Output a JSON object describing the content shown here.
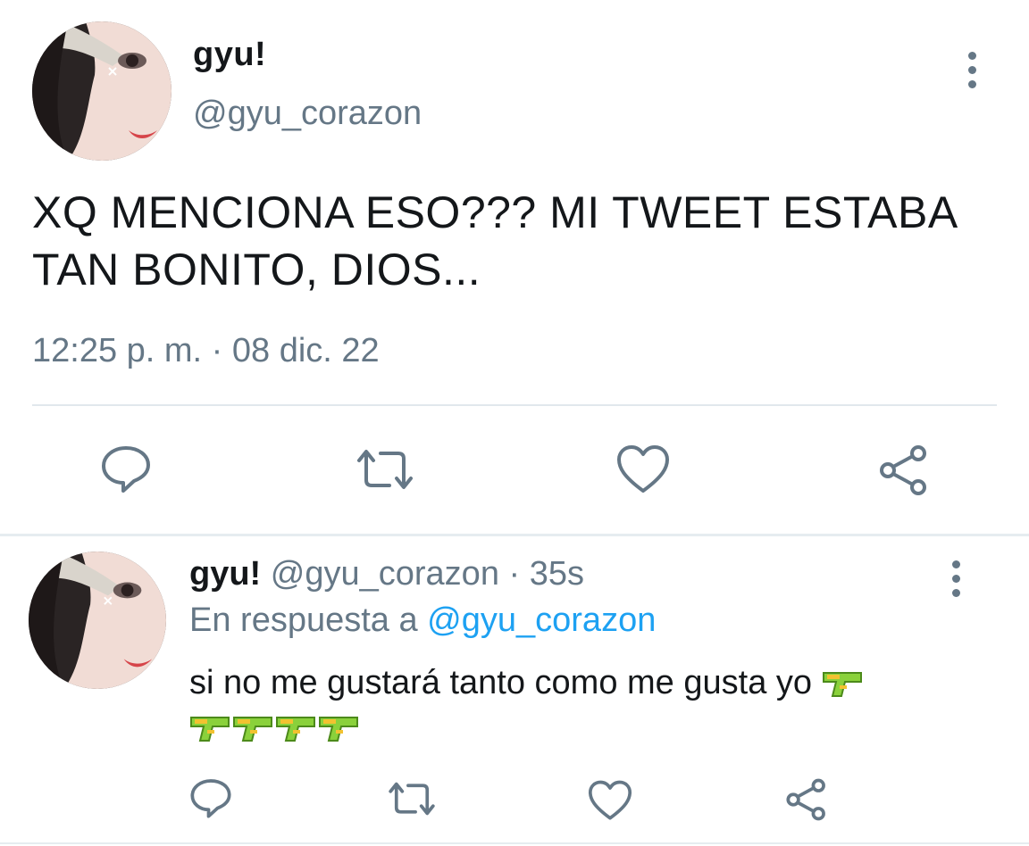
{
  "main_tweet": {
    "display_name": "gyu!",
    "handle": "@gyu_corazon",
    "text": "XQ MENCIONA ESO??? MI TWEET ESTABA TAN BONITO, DIOS...",
    "timestamp": "12:25 p. m. · 08 dic. 22",
    "icons": {
      "more": "more-vertical-icon",
      "reply": "comment-icon",
      "retweet": "retweet-icon",
      "like": "heart-icon",
      "share": "share-icon"
    }
  },
  "reply_tweet": {
    "display_name": "gyu!",
    "handle": "@gyu_corazon",
    "time": "· 35s",
    "replying_to_label": "En respuesta a",
    "replying_to_handle": "@gyu_corazon",
    "text": "si no me gustará tanto como me gusta yo",
    "emoji": "water-pistol",
    "emoji_count": 5
  },
  "colors": {
    "text": "#14171a",
    "secondary": "#657786",
    "accent": "#1da1f2",
    "divider": "#e1e8ed"
  }
}
